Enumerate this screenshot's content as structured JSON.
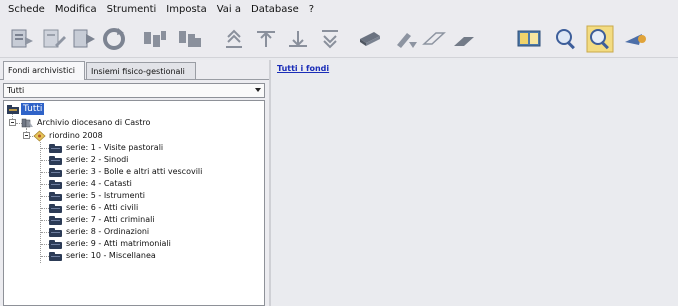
{
  "menu": [
    "Schede",
    "Modifica",
    "Strumenti",
    "Imposta",
    "Vai a",
    "Database",
    "?"
  ],
  "toolbar": {
    "buttons": [
      "new-record-icon",
      "edit-record-icon",
      "next-record-icon",
      "refresh-icon",
      "move-up-icon",
      "move-down-icon",
      "move-top-icon",
      "move-to-top-bar-icon",
      "move-to-bottom-bar-icon",
      "move-bottom-icon",
      "archive-icon",
      "pencil-arrow-icon",
      "eraser-icon",
      "eraser-dark-icon",
      "book-icon",
      "search-icon",
      "search-highlight-icon",
      "send-icon"
    ]
  },
  "left": {
    "tabs": [
      "Fondi archivistici",
      "Insiemi fisico-gestionali"
    ],
    "combo_value": "Tutti",
    "tree": {
      "root": "Tutti",
      "fund": "Archivio diocesano di Castro",
      "group": "riordino 2008",
      "series": [
        "serie: 1 - Visite pastorali",
        "serie: 2 - Sinodi",
        "serie: 3 - Bolle e altri atti vescovili",
        "serie: 4 - Catasti",
        "serie: 5 - Istrumenti",
        "serie: 6 - Atti civili",
        "serie: 7 - Atti criminali",
        "serie: 8 - Ordinazioni",
        "serie: 9 - Atti matrimoniali",
        "serie: 10 - Miscellanea"
      ]
    }
  },
  "right": {
    "breadcrumb": "Tutti i fondi"
  },
  "colors": {
    "selection": "#2f63c8",
    "link": "#1a2db8",
    "folder": "#2c3b56"
  }
}
